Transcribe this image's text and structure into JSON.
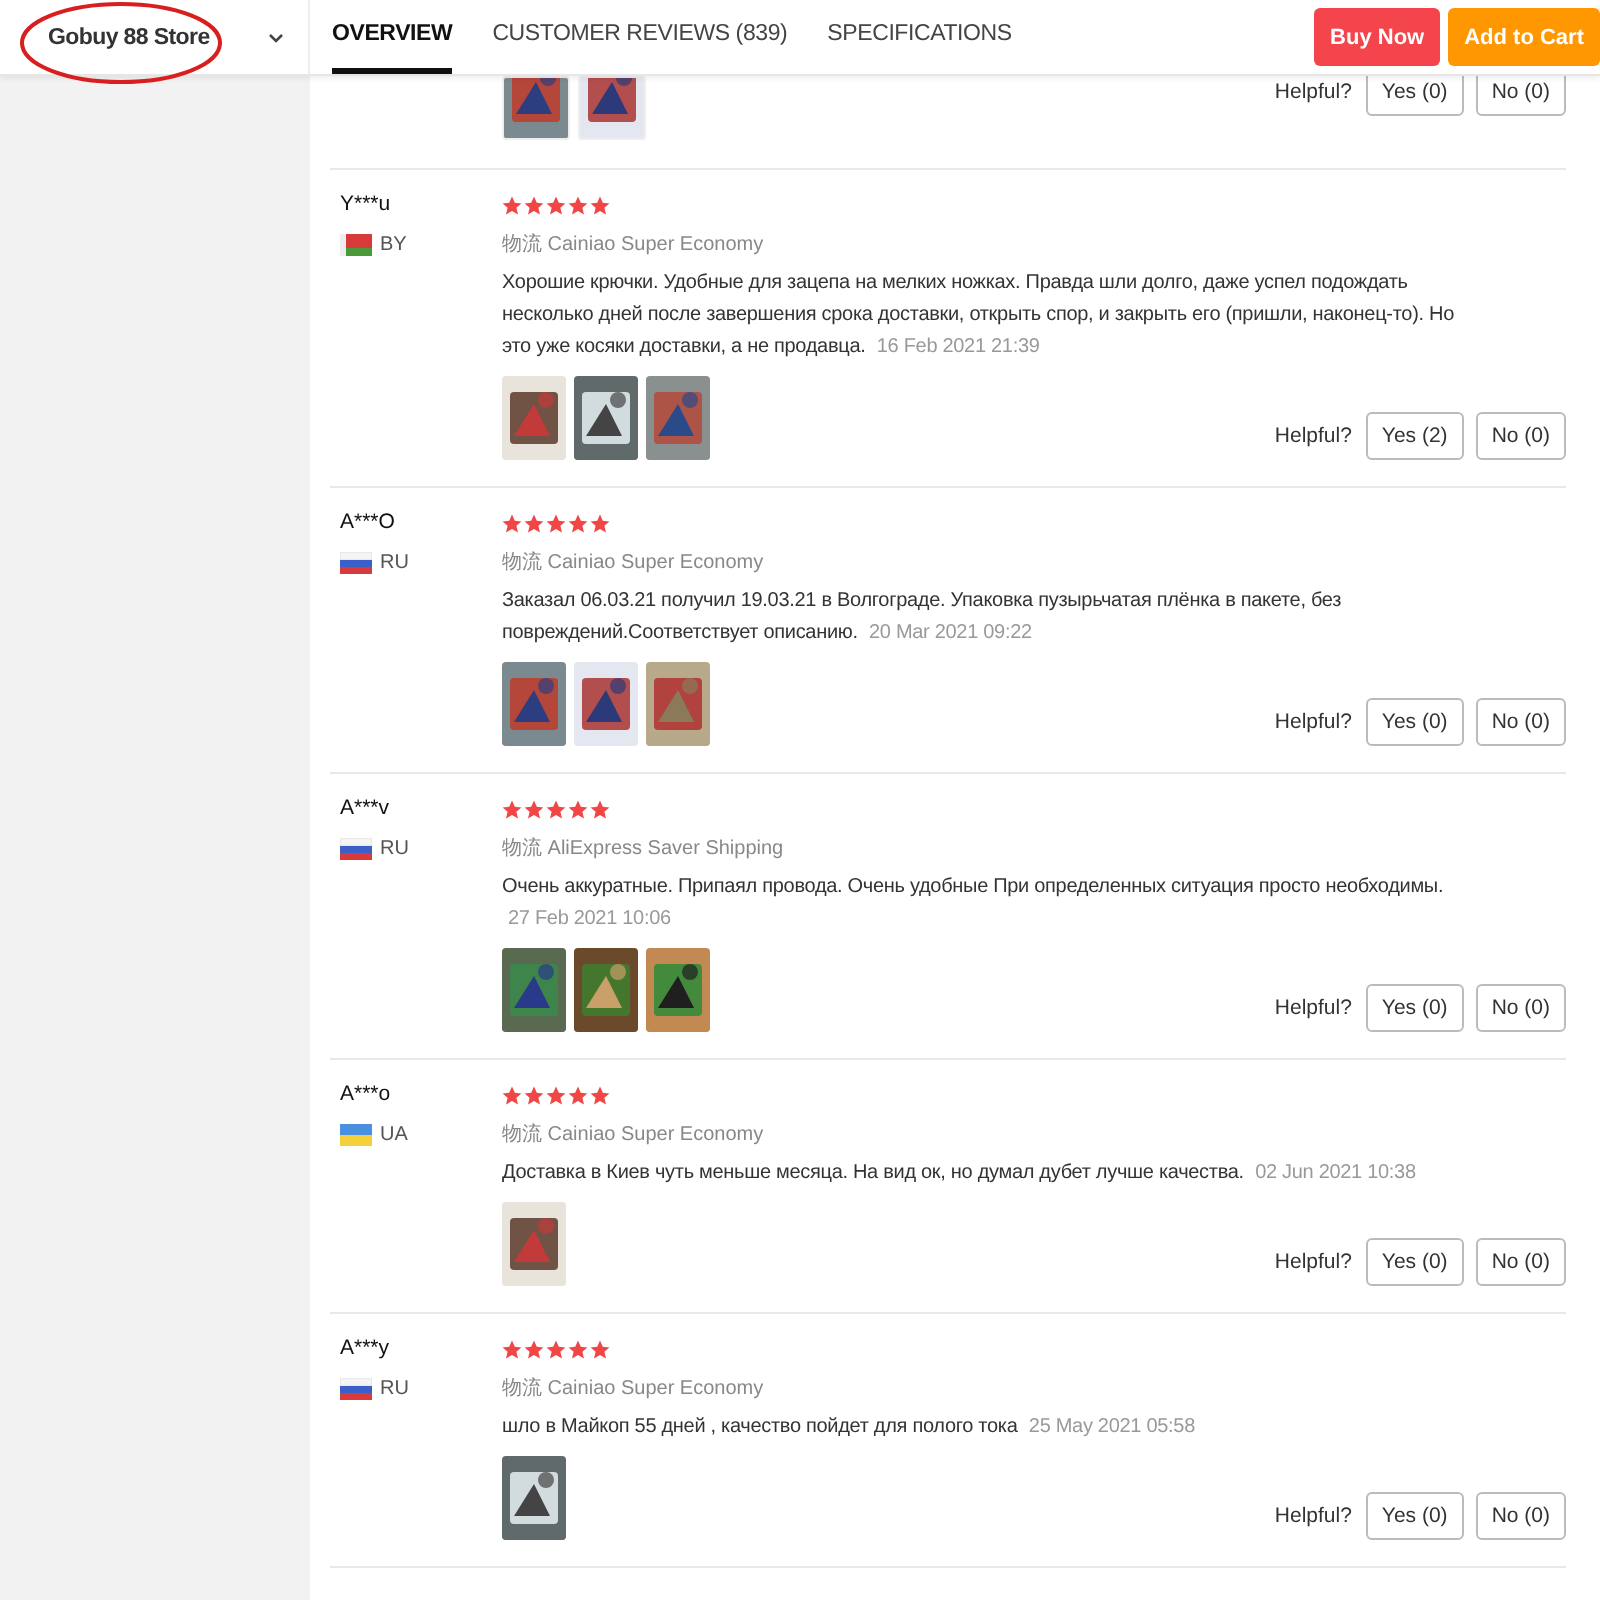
{
  "header": {
    "store_name": "Gobuy 88 Store",
    "annotation_circled": true,
    "tabs": [
      {
        "label": "OVERVIEW",
        "selected": true
      },
      {
        "label": "CUSTOMER REVIEWS (839)",
        "selected": false
      },
      {
        "label": "SPECIFICATIONS",
        "selected": false
      }
    ],
    "buttons": [
      {
        "label": "Buy Now",
        "kind": "buy"
      },
      {
        "label": "Add to Cart",
        "kind": "cart"
      }
    ]
  },
  "partial_review": {
    "photos": [
      {
        "kind": "picture"
      },
      {
        "kind": "picture"
      }
    ],
    "helpful_label": "Helpful?",
    "yes": "Yes (0)",
    "no": "No (0)"
  },
  "reviews": [
    {
      "name": "Y***u",
      "kind": "belarus",
      "country": "BY",
      "stars": 5,
      "shipping_prefix": "物流",
      "shipping": "Cainiao Super Economy",
      "text": "Хорошие крючки. Удобные для зацепа на мелких ножках. Правда шли долго, даже успел подождать несколько дней после завершения срока доставки, открыть спор, и закрыть его (пришли, наконец-то). Но это уже косяки доставки, а не продавца.",
      "date": "16 Feb 2021 21:39",
      "photos": [
        {
          "kind": "picture"
        },
        {
          "kind": "picture"
        },
        {
          "kind": "picture"
        }
      ],
      "helpful_label": "Helpful?",
      "yes": "Yes (2)",
      "no": "No (0)"
    },
    {
      "name": "A***O",
      "kind": "russia",
      "country": "RU",
      "stars": 5,
      "shipping_prefix": "物流",
      "shipping": "Cainiao Super Economy",
      "text": "Заказал 06.03.21 получил 19.03.21 в Волгограде. Упаковка пузырьчатая плёнка в пакете, без повреждений.Соответствует описанию.",
      "date": "20 Mar 2021 09:22",
      "photos": [
        {
          "kind": "picture"
        },
        {
          "kind": "picture"
        },
        {
          "kind": "picture"
        }
      ],
      "helpful_label": "Helpful?",
      "yes": "Yes (0)",
      "no": "No (0)"
    },
    {
      "name": "A***v",
      "kind": "russia",
      "country": "RU",
      "stars": 5,
      "shipping_prefix": "物流",
      "shipping": "AliExpress Saver Shipping",
      "text": "Очень аккуратные. Припаял провода. Очень удобные При определенных ситуация просто необходимы.",
      "date": "27 Feb 2021 10:06",
      "photos": [
        {
          "kind": "picture"
        },
        {
          "kind": "picture"
        },
        {
          "kind": "picture"
        }
      ],
      "helpful_label": "Helpful?",
      "yes": "Yes (0)",
      "no": "No (0)"
    },
    {
      "name": "A***o",
      "kind": "ukraine",
      "country": "UA",
      "stars": 5,
      "shipping_prefix": "物流",
      "shipping": "Cainiao Super Economy",
      "text": "Доставка в Киев чуть меньше месяца. На вид ок, но думал дубет лучше качества.",
      "date": "02 Jun 2021 10:38",
      "photos": [
        {
          "kind": "picture"
        }
      ],
      "helpful_label": "Helpful?",
      "yes": "Yes (0)",
      "no": "No (0)"
    },
    {
      "name": "A***y",
      "kind": "russia",
      "country": "RU",
      "stars": 5,
      "shipping_prefix": "物流",
      "shipping": "Cainiao Super Economy",
      "text": "шло в Майкоп 55 дней , качество пойдет для полого тока",
      "date": "25 May 2021 05:58",
      "photos": [
        {
          "kind": "picture"
        }
      ],
      "helpful_label": "Helpful?",
      "yes": "Yes (0)",
      "no": "No (0)"
    }
  ]
}
